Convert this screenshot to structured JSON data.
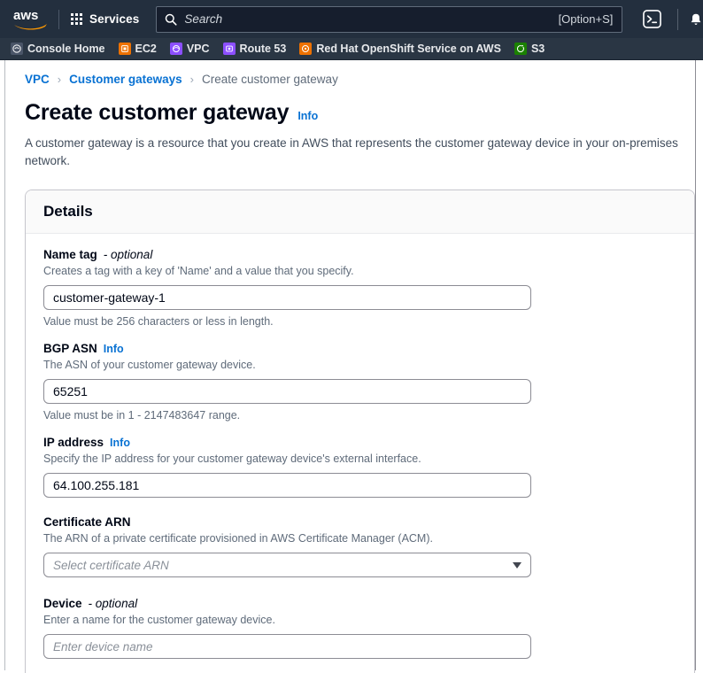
{
  "topnav": {
    "logo_alt": "aws",
    "services_label": "Services",
    "search": {
      "placeholder": "Search",
      "shortcut": "[Option+S]"
    },
    "cloudshell_icon": "cloudshell-icon",
    "notifications_icon": "notifications-bell-icon"
  },
  "favorites": [
    {
      "label": "Console Home",
      "icon": "console-home-icon",
      "color": "#5f6b7a"
    },
    {
      "label": "EC2",
      "icon": "ec2-icon",
      "color": "#ed7100"
    },
    {
      "label": "VPC",
      "icon": "vpc-icon",
      "color": "#8c4fff"
    },
    {
      "label": "Route 53",
      "icon": "route53-icon",
      "color": "#8c4fff"
    },
    {
      "label": "Red Hat OpenShift Service on AWS",
      "icon": "rosa-icon",
      "color": "#ed7100"
    },
    {
      "label": "S3",
      "icon": "s3-icon",
      "color": "#1b8102"
    }
  ],
  "breadcrumb": {
    "items": [
      "VPC",
      "Customer gateways",
      "Create customer gateway"
    ],
    "separator": "›"
  },
  "header": {
    "title": "Create customer gateway",
    "info_label": "Info",
    "description": "A customer gateway is a resource that you create in AWS that represents the customer gateway device in your on-premises network."
  },
  "details_card": {
    "heading": "Details",
    "fields": [
      {
        "label": "Name tag",
        "optional_suffix": "- optional",
        "info_label": "",
        "description": "Creates a tag with a key of 'Name' and a value that you specify.",
        "value": "customer-gateway-1",
        "placeholder": "",
        "constraint": "Value must be 256 characters or less in length.",
        "type": "text"
      },
      {
        "label": "BGP ASN",
        "optional_suffix": "",
        "info_label": "Info",
        "description": "The ASN of your customer gateway device.",
        "value": "65251",
        "placeholder": "",
        "constraint": "Value must be in 1 - 2147483647 range.",
        "type": "text"
      },
      {
        "label": "IP address",
        "optional_suffix": "",
        "info_label": "Info",
        "description": "Specify the IP address for your customer gateway device's external interface.",
        "value": "64.100.255.181",
        "placeholder": "",
        "constraint": "",
        "type": "text"
      },
      {
        "label": "Certificate ARN",
        "optional_suffix": "",
        "info_label": "",
        "description": "The ARN of a private certificate provisioned in AWS Certificate Manager (ACM).",
        "value": "",
        "placeholder": "Select certificate ARN",
        "constraint": "",
        "type": "select"
      },
      {
        "label": "Device",
        "optional_suffix": "- optional",
        "info_label": "",
        "description": "Enter a name for the customer gateway device.",
        "value": "",
        "placeholder": "Enter device name",
        "constraint": "",
        "type": "text"
      }
    ]
  },
  "colors": {
    "nav_bg": "#232f3e",
    "fav_bg": "#2a3644",
    "link_blue": "#0972d3",
    "text_dark": "#000716",
    "text_muted": "#5f6b7a",
    "aws_orange": "#ff9900"
  }
}
